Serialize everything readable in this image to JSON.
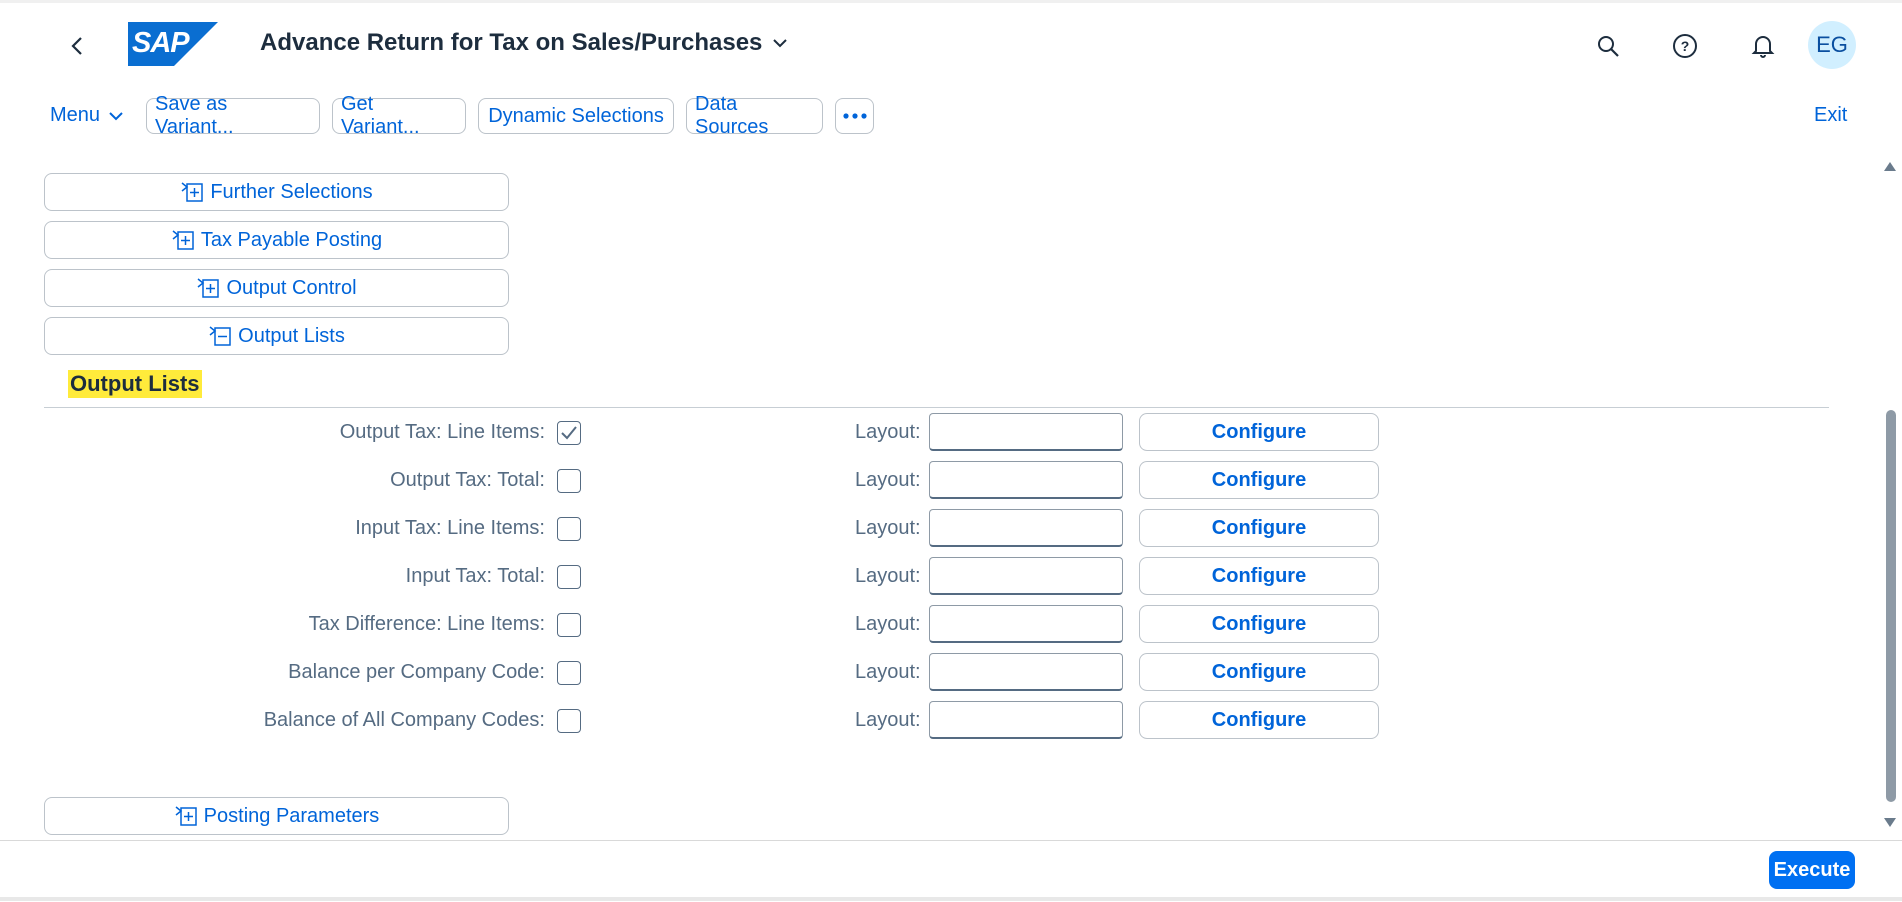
{
  "header": {
    "logo_text": "SAP",
    "title": "Advance Return for Tax on Sales/Purchases",
    "avatar": "EG",
    "icons": [
      "search-icon",
      "help-icon",
      "bell-icon"
    ]
  },
  "toolbar": {
    "menu_label": "Menu",
    "buttons": [
      "Save as Variant...",
      "Get Variant...",
      "Dynamic Selections",
      "Data Sources"
    ],
    "more_icon": "more-icon",
    "exit_label": "Exit"
  },
  "sections": {
    "further_selections": "Further Selections",
    "tax_payable_posting": "Tax Payable Posting",
    "output_control": "Output Control",
    "output_lists": "Output Lists",
    "posting_parameters": "Posting Parameters"
  },
  "output_lists": {
    "title": "Output Lists",
    "layout_label": "Layout:",
    "configure_label": "Configure",
    "rows": [
      {
        "label": "Output Tax: Line Items:",
        "checked": true,
        "layout": ""
      },
      {
        "label": "Output Tax: Total:",
        "checked": false,
        "layout": ""
      },
      {
        "label": "Input Tax: Line Items:",
        "checked": false,
        "layout": ""
      },
      {
        "label": "Input Tax: Total:",
        "checked": false,
        "layout": ""
      },
      {
        "label": "Tax Difference: Line Items:",
        "checked": false,
        "layout": ""
      },
      {
        "label": "Balance per Company Code:",
        "checked": false,
        "layout": ""
      },
      {
        "label": "Balance of All Company Codes:",
        "checked": false,
        "layout": ""
      }
    ]
  },
  "footer": {
    "execute_label": "Execute"
  },
  "colors": {
    "accent": "#0064d9",
    "execute": "#0070f2",
    "highlight": "#ffeb3b"
  }
}
